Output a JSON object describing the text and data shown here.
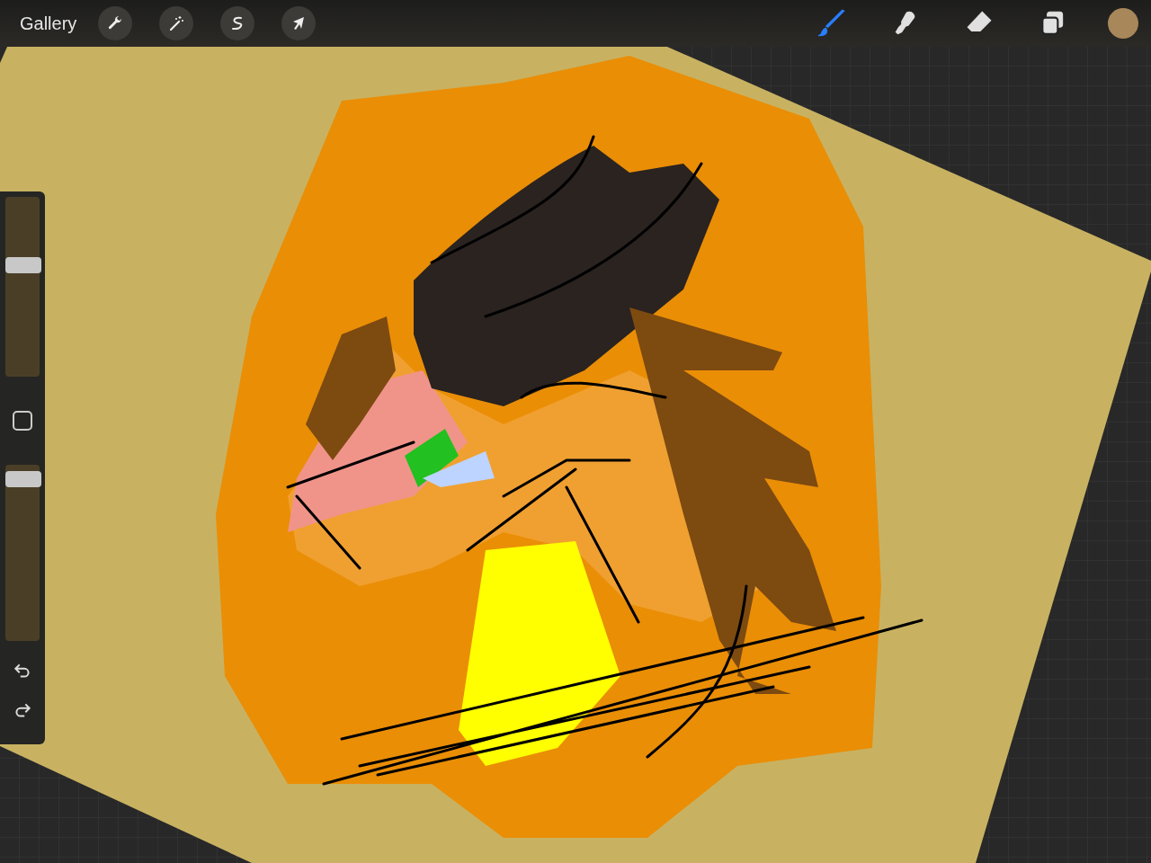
{
  "toolbar": {
    "gallery": "Gallery",
    "actions": [
      {
        "kind": "wrench"
      },
      {
        "kind": "wand"
      },
      {
        "kind": "selection"
      },
      {
        "kind": "transform"
      }
    ],
    "tools": [
      {
        "kind": "brush",
        "selected": true
      },
      {
        "kind": "smudge",
        "selected": false
      },
      {
        "kind": "eraser",
        "selected": false
      },
      {
        "kind": "layers",
        "selected": false
      }
    ],
    "color": "#a8875a"
  },
  "sidebar": {
    "size_slider": {
      "level": 0.63
    },
    "opacity_slider": {
      "level": 0.96
    }
  }
}
